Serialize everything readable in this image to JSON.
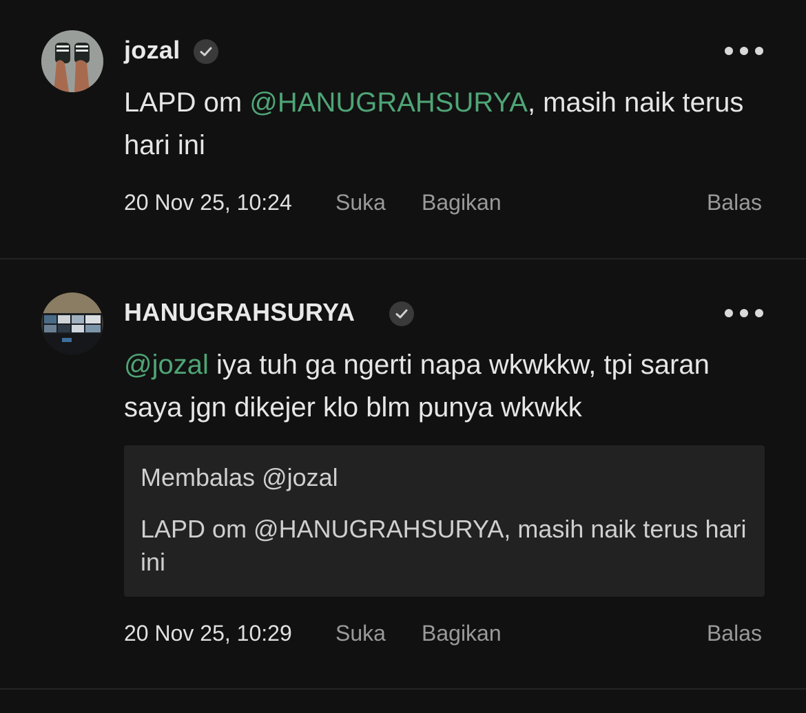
{
  "comments": [
    {
      "avatar_icon": "user-avatar-sandals",
      "username": "jozal",
      "verified_icon": "verified-check-icon",
      "more_icon": "more-options-icon",
      "mention": "",
      "text_prefix": "LAPD om ",
      "text_mention": "@HANUGRAHSURYA",
      "text_suffix": ", masih naik terus hari ini",
      "timestamp": "20 Nov 25, 10:24",
      "like_label": "Suka",
      "share_label": "Bagikan",
      "reply_label": "Balas"
    },
    {
      "avatar_icon": "user-avatar-monitors",
      "username": "HANUGRAHSURYA",
      "verified_icon": "verified-check-icon",
      "more_icon": "more-options-icon",
      "text_mention": "@jozal",
      "text_body": " iya tuh ga ngerti napa wkwkkw, tpi saran saya jgn dikejer klo blm punya wkwkk",
      "quote": {
        "header": "Membalas @jozal",
        "text": "LAPD om @HANUGRAHSURYA, masih naik terus hari ini"
      },
      "timestamp": "20 Nov 25, 10:29",
      "like_label": "Suka",
      "share_label": "Bagikan",
      "reply_label": "Balas"
    }
  ],
  "colors": {
    "background": "#111111",
    "mention": "#4fa576",
    "text": "#e6e6e6",
    "muted": "#9a9a9a",
    "quote_bg": "#222222"
  }
}
